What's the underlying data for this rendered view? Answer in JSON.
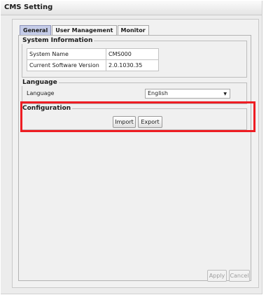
{
  "window": {
    "title": "CMS Setting"
  },
  "tabs": [
    {
      "label": "General",
      "active": true
    },
    {
      "label": "User Management",
      "active": false
    },
    {
      "label": "Monitor",
      "active": false
    }
  ],
  "system_information": {
    "legend": "System Information",
    "rows": [
      {
        "label": "System Name",
        "value": "CMS000"
      },
      {
        "label": "Current Software Version",
        "value": "2.0.1030.35"
      }
    ]
  },
  "language": {
    "legend": "Language",
    "label": "Language",
    "selected": "English"
  },
  "configuration": {
    "legend": "Configuration",
    "import_label": "Import",
    "export_label": "Export"
  },
  "footer": {
    "apply_label": "Apply",
    "cancel_label": "Cancel"
  },
  "colors": {
    "highlight": "#ee1d23",
    "active_tab": "#c5cce8"
  }
}
